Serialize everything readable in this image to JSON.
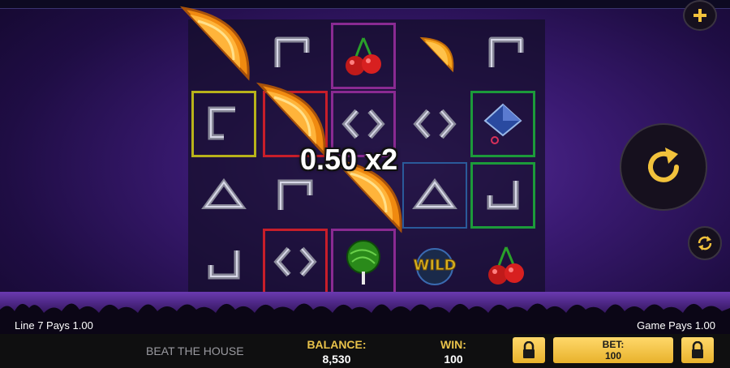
{
  "game": {
    "title": "BEAT THE HOUSE"
  },
  "win_display": {
    "text": "0.50 x2"
  },
  "line_info": {
    "left": "Line 7 Pays 1.00",
    "right": "Game Pays 1.00"
  },
  "stats": {
    "balance_label": "BALANCE:",
    "balance_value": "8,530",
    "win_label": "WIN:",
    "win_value": "100",
    "bet_label": "BET:",
    "bet_value": "100"
  },
  "symbols": {
    "wild_text": "WILD"
  },
  "colors": {
    "accent": "#e8c24a",
    "gold_button": "#f2c23c",
    "background": "#3a1a72"
  },
  "icons": [
    "plus-icon",
    "spin-arrow-icon",
    "autoplay-icon",
    "lock-icon",
    "orange-slice-icon",
    "cherry-icon",
    "diamond-icon",
    "bracket-icon",
    "lollipop-icon",
    "wild-icon"
  ]
}
